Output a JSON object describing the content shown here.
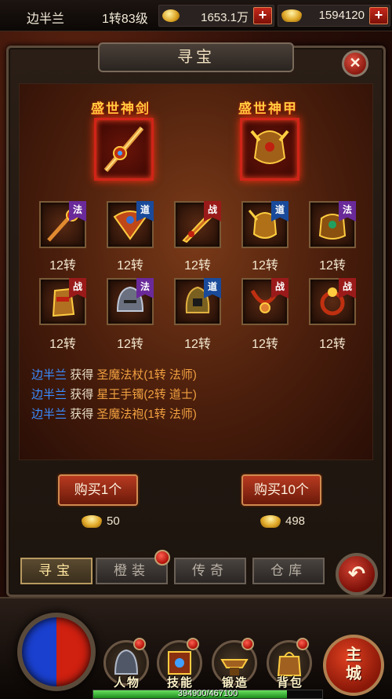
{
  "player": {
    "name": "边半兰",
    "level": "1转83级"
  },
  "currency": {
    "coins": "1653.1万",
    "ingots": "1594120",
    "plus": "+"
  },
  "window": {
    "title": "寻宝",
    "close": "✕"
  },
  "featured": [
    {
      "title": "盛世神剑",
      "icon": "sword-icon"
    },
    {
      "title": "盛世神甲",
      "icon": "armor-icon"
    }
  ],
  "items": [
    {
      "label": "12转",
      "class_tag": "法",
      "class_type": "fa",
      "icon": "staff-icon"
    },
    {
      "label": "12转",
      "class_tag": "道",
      "class_type": "dao",
      "icon": "fan-icon"
    },
    {
      "label": "12转",
      "class_tag": "战",
      "class_type": "zhan",
      "icon": "blade-icon"
    },
    {
      "label": "12转",
      "class_tag": "道",
      "class_type": "dao",
      "icon": "armor-icon"
    },
    {
      "label": "12转",
      "class_tag": "法",
      "class_type": "fa",
      "icon": "robe-icon"
    },
    {
      "label": "12转",
      "class_tag": "战",
      "class_type": "zhan",
      "icon": "gauntlet-icon"
    },
    {
      "label": "12转",
      "class_tag": "法",
      "class_type": "fa",
      "icon": "helmet-icon"
    },
    {
      "label": "12转",
      "class_tag": "道",
      "class_type": "dao",
      "icon": "helmet-icon"
    },
    {
      "label": "12转",
      "class_tag": "战",
      "class_type": "zhan",
      "icon": "necklace-icon"
    },
    {
      "label": "12转",
      "class_tag": "战",
      "class_type": "zhan",
      "icon": "ring-icon"
    }
  ],
  "log": [
    {
      "who": "边半兰",
      "verb": "获得",
      "item": "圣魔法杖(1转 法师)"
    },
    {
      "who": "边半兰",
      "verb": "获得",
      "item": "星王手镯(2转 道士)"
    },
    {
      "who": "边半兰",
      "verb": "获得",
      "item": "圣魔法袍(1转 法师)"
    }
  ],
  "buy": [
    {
      "label": "购买1个",
      "price": "50"
    },
    {
      "label": "购买10个",
      "price": "498"
    }
  ],
  "tabs": [
    {
      "label": "寻宝",
      "active": true
    },
    {
      "label": "橙装",
      "active": false
    },
    {
      "label": "传奇",
      "active": false
    },
    {
      "label": "仓库",
      "active": false
    }
  ],
  "back": "↶",
  "hud": {
    "buttons": [
      "人物",
      "技能",
      "锻造",
      "背包"
    ],
    "main_city": "主城",
    "xp_text": "394900/467100",
    "xp_fraction": 0.845
  }
}
